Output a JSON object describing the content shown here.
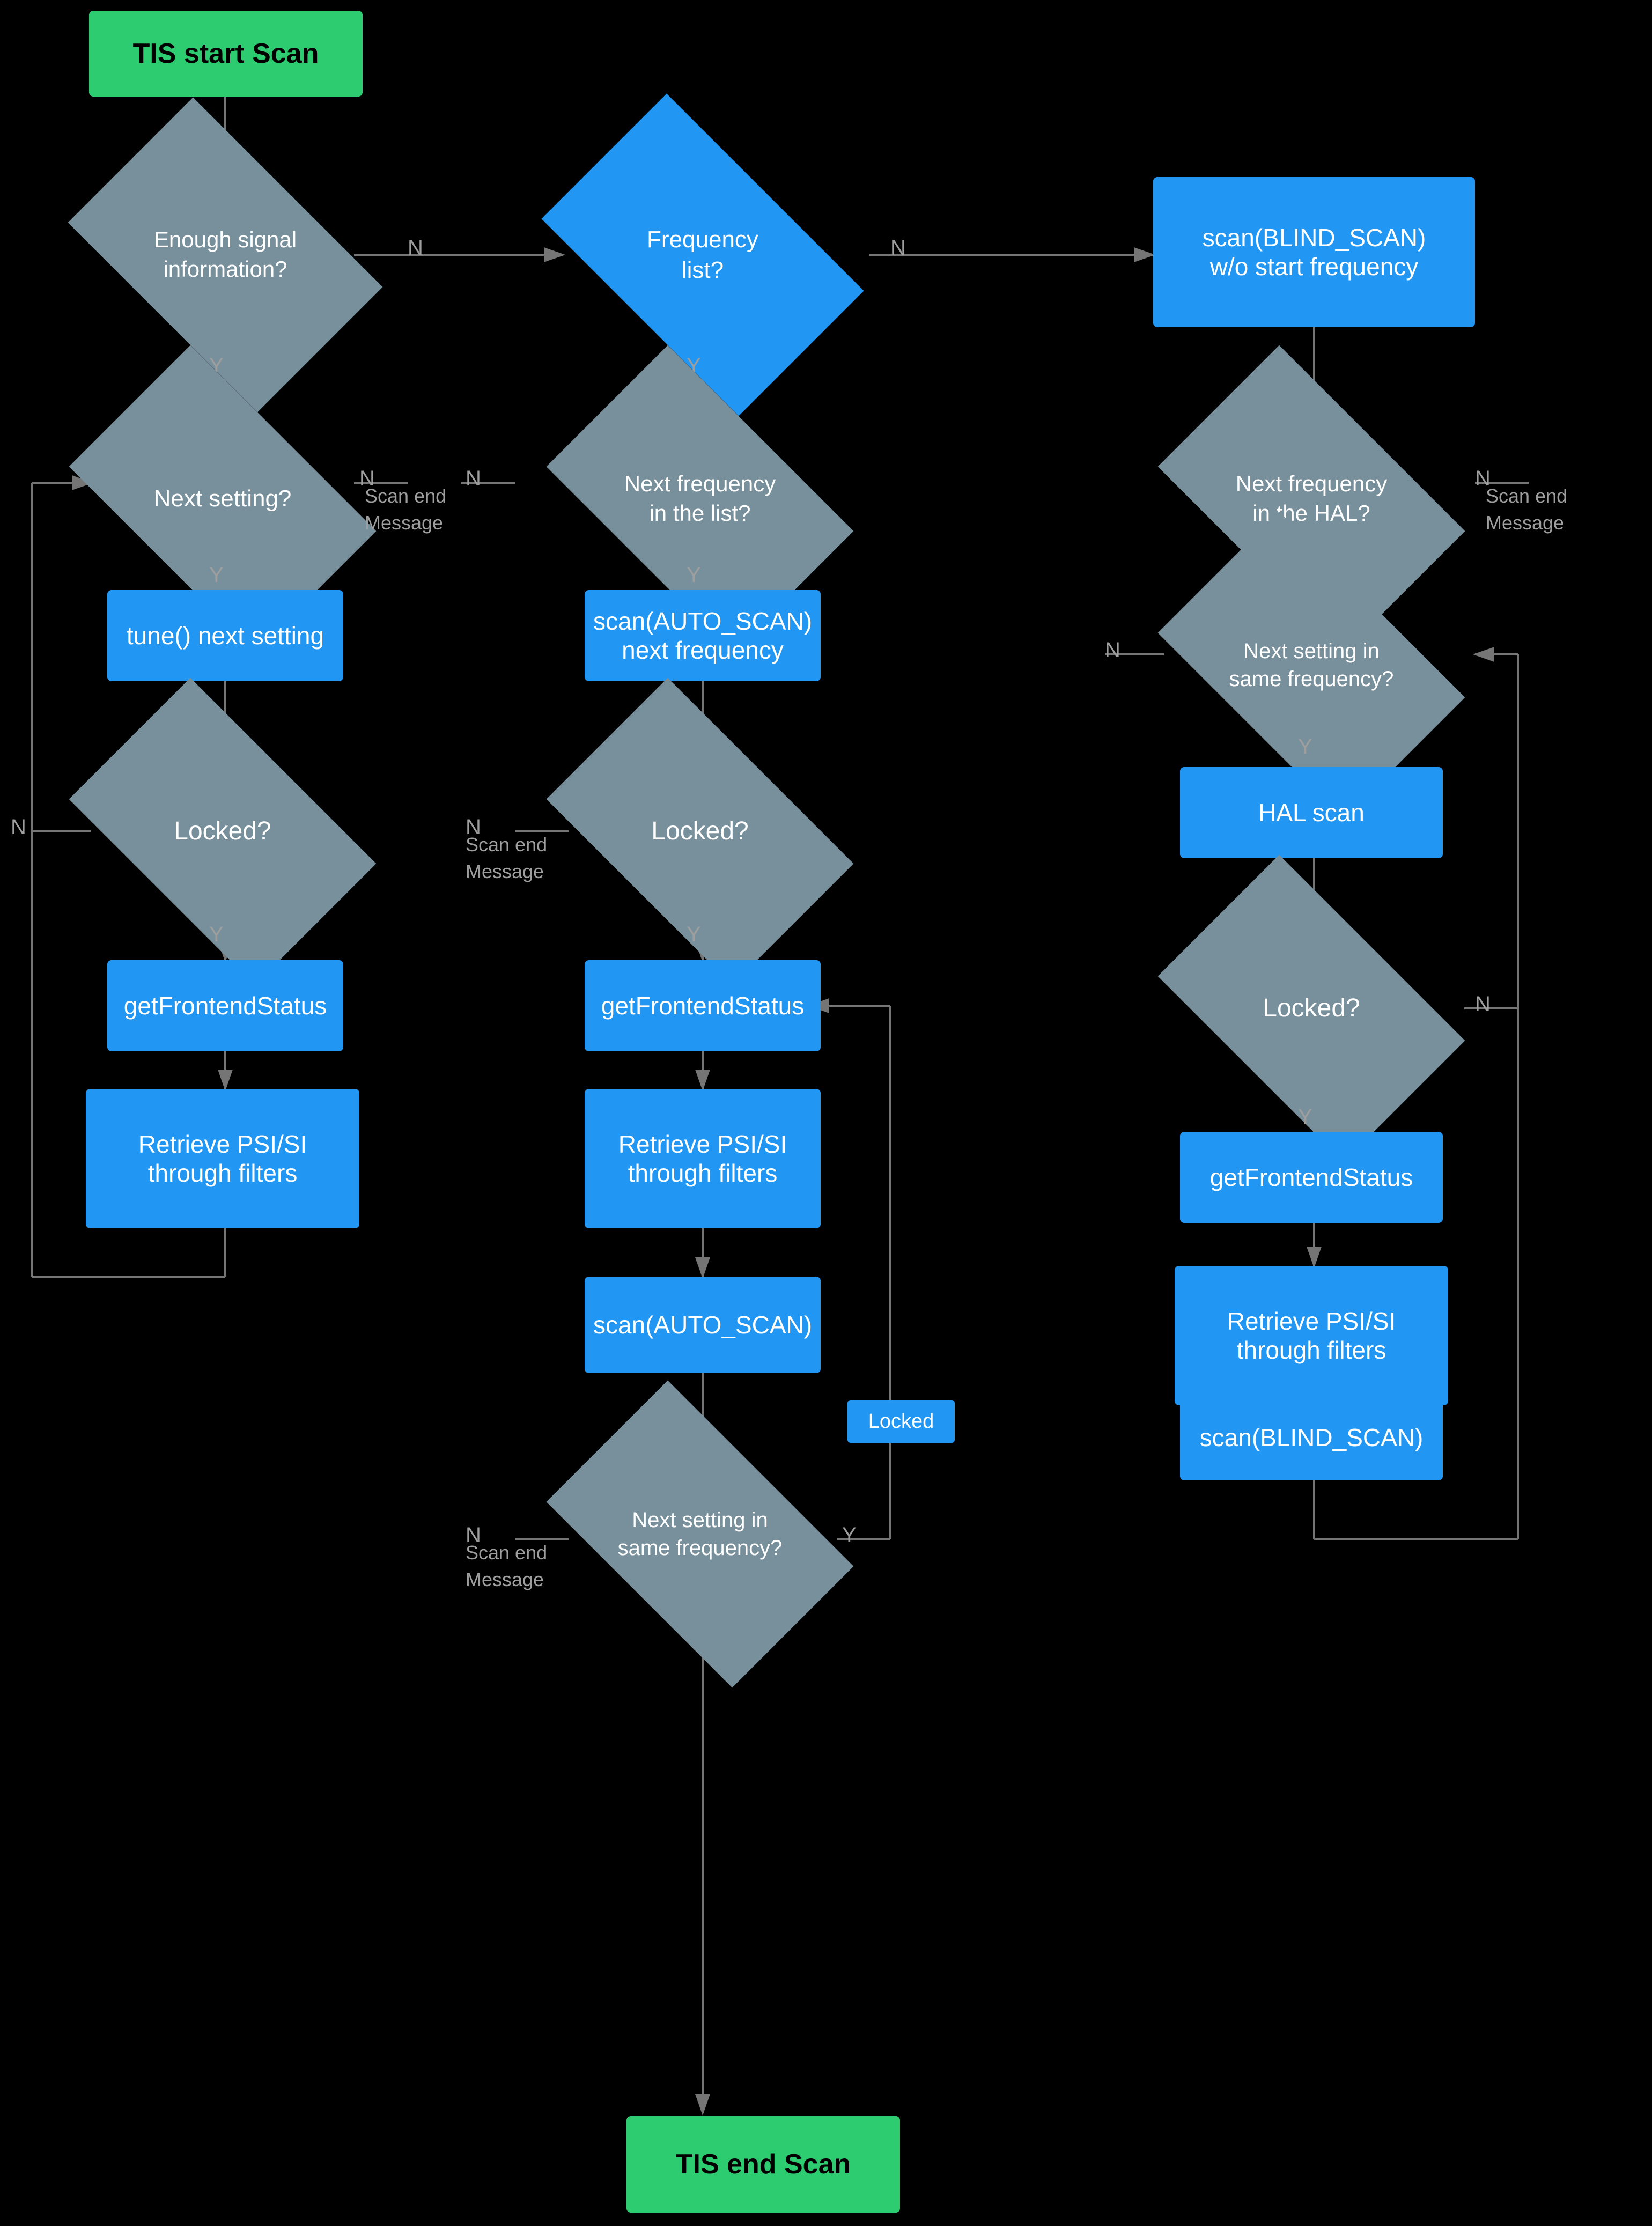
{
  "nodes": {
    "start": {
      "label": "TIS start Scan"
    },
    "end": {
      "label": "TIS end Scan"
    },
    "d_enough_signal": {
      "label": "Enough signal\ninformation?"
    },
    "d_frequency_list": {
      "label": "Frequency\nlist?"
    },
    "rect_blind_scan_no_start": {
      "label": "scan(BLIND_SCAN)\nw/o start frequency"
    },
    "d_next_setting": {
      "label": "Next setting?"
    },
    "d_next_freq_in_list": {
      "label": "Next frequency\nin the list?"
    },
    "d_next_freq_hal": {
      "label": "Next frequency\nin the HAL?"
    },
    "rect_tune_next": {
      "label": "tune() next setting"
    },
    "rect_scan_auto_next": {
      "label": "scan(AUTO_SCAN)\nnext frequency"
    },
    "d_next_setting_same_freq_right": {
      "label": "Next setting in\nsame frequency?"
    },
    "d_locked_left": {
      "label": "Locked?"
    },
    "d_locked_mid": {
      "label": "Locked?"
    },
    "rect_hal_scan": {
      "label": "HAL scan"
    },
    "rect_get_fe_left": {
      "label": "getFrontendStatus"
    },
    "rect_get_fe_mid": {
      "label": "getFrontendStatus"
    },
    "d_locked_right": {
      "label": "Locked?"
    },
    "rect_psi_left": {
      "label": "Retrieve PSI/SI\nthrough filters"
    },
    "rect_psi_mid": {
      "label": "Retrieve PSI/SI\nthrough filters"
    },
    "rect_get_fe_right": {
      "label": "getFrontendStatus"
    },
    "rect_scan_auto": {
      "label": "scan(AUTO_SCAN)"
    },
    "rect_psi_right": {
      "label": "Retrieve PSI/SI\nthrough filters"
    },
    "d_next_setting_same_freq_mid": {
      "label": "Next setting in\nsame frequency?"
    },
    "rect_blind_scan": {
      "label": "scan(BLIND_SCAN)"
    },
    "badge_locked": {
      "label": "Locked"
    },
    "label_n1": {
      "label": "N"
    },
    "label_n2": {
      "label": "N"
    },
    "label_n3": {
      "label": "N"
    },
    "label_n4": {
      "label": "N"
    },
    "label_n5": {
      "label": "N"
    },
    "label_n6": {
      "label": "N"
    },
    "label_n7": {
      "label": "N"
    },
    "label_y1": {
      "label": "Y"
    },
    "label_y2": {
      "label": "Y"
    },
    "label_y3": {
      "label": "Y"
    },
    "label_y4": {
      "label": "Y"
    },
    "label_y5": {
      "label": "Y"
    },
    "label_y6": {
      "label": "Y"
    },
    "label_y7": {
      "label": "Y"
    },
    "label_scan_end_1": {
      "label": "Scan end\nMessage"
    },
    "label_scan_end_2": {
      "label": "Scan end\nMessage"
    },
    "label_scan_end_3": {
      "label": "Scan end\nMessage"
    },
    "label_scan_end_4": {
      "label": "Scan end\nMessage"
    }
  }
}
